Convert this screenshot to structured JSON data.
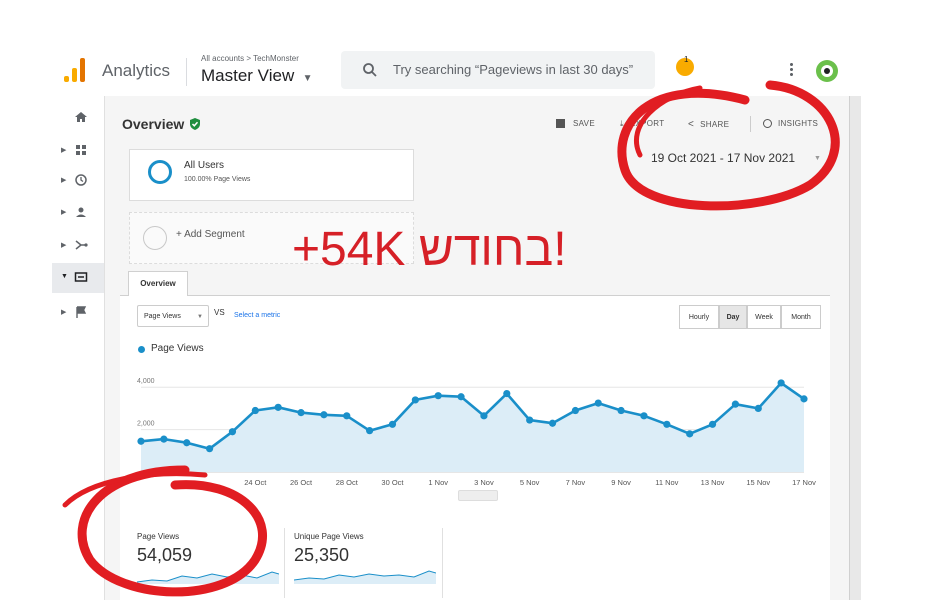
{
  "header": {
    "app_name": "Analytics",
    "breadcrumb": "All accounts > TechMonster",
    "view_name": "Master View",
    "search_placeholder": "Try searching “Pageviews in last 30 days”",
    "notification_count": "1"
  },
  "toolbar": {
    "title": "Overview",
    "save": "SAVE",
    "export": "EXPORT",
    "share": "SHARE",
    "insights": "INSIGHTS",
    "date_range": "19 Oct 2021 - 17 Nov 2021"
  },
  "segments": {
    "all_users": "All Users",
    "all_users_sub": "100.00% Page Views",
    "add_segment": "+ Add Segment"
  },
  "tabs": {
    "overview": "Overview"
  },
  "controls": {
    "metric": "Page Views",
    "vs": "VS",
    "select_metric": "Select a metric",
    "granularity": [
      "Hourly",
      "Day",
      "Week",
      "Month"
    ],
    "granularity_selected": "Day"
  },
  "legend": {
    "series": "Page Views"
  },
  "chart_data": {
    "type": "area",
    "series": [
      {
        "name": "Page Views",
        "values": [
          1450,
          1550,
          1380,
          1100,
          1900,
          2900,
          3050,
          2800,
          2700,
          2650,
          1950,
          2250,
          3400,
          3600,
          3550,
          2650,
          3700,
          2450,
          2300,
          2900,
          3250,
          2900,
          2650,
          2250,
          1800,
          2250,
          3200,
          3000,
          4200,
          3450
        ]
      }
    ],
    "x_tick_labels": [
      "24 Oct",
      "26 Oct",
      "28 Oct",
      "30 Oct",
      "1 Nov",
      "3 Nov",
      "5 Nov",
      "7 Nov",
      "9 Nov",
      "11 Nov",
      "13 Nov",
      "15 Nov",
      "17 Nov"
    ],
    "y_tick_labels": [
      "4,000",
      "2,000"
    ],
    "ylim": [
      0,
      5000
    ],
    "color": "#1a8fc9",
    "fill": "#dcedf7"
  },
  "kpis": [
    {
      "label": "Page Views",
      "value": "54,059"
    },
    {
      "label": "Unique Page Views",
      "value": "25,350"
    }
  ],
  "annotation": {
    "text": "+54K בחודש!",
    "color": "#d62027"
  }
}
